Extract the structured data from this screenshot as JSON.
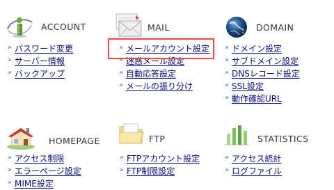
{
  "sections": {
    "account": {
      "title": "ACCOUNT",
      "icon": "account-info-icon",
      "links": [
        "パスワード変更",
        "サーバー情報",
        "バックアップ"
      ]
    },
    "mail": {
      "title": "MAIL",
      "icon": "mail-envelope-icon",
      "links": [
        "メールアカウント設定",
        "迷惑メール設定",
        "自動応答設定",
        "メールの振り分け"
      ]
    },
    "domain": {
      "title": "DOMAIN",
      "icon": "globe-icon",
      "links": [
        "ドメイン設定",
        "サブドメイン設定",
        "DNSレコード設定",
        "SSL設定",
        "動作確認URL"
      ]
    },
    "homepage": {
      "title": "HOMEPAGE",
      "icon": "house-icon",
      "links": [
        "アクセス制限",
        "エラーページ設定",
        "MIME設定"
      ]
    },
    "ftp": {
      "title": "FTP",
      "icon": "folder-icon",
      "links": [
        "FTPアカウント設定",
        "FTP制限設定"
      ]
    },
    "statistics": {
      "title": "STATISTICS",
      "icon": "bar-chart-icon",
      "links": [
        "アクセス統計",
        "ログファイル"
      ]
    }
  },
  "highlight_color": "#e84a4a",
  "link_color": "#0a0a7a",
  "bullet_color": "#4a78b8"
}
